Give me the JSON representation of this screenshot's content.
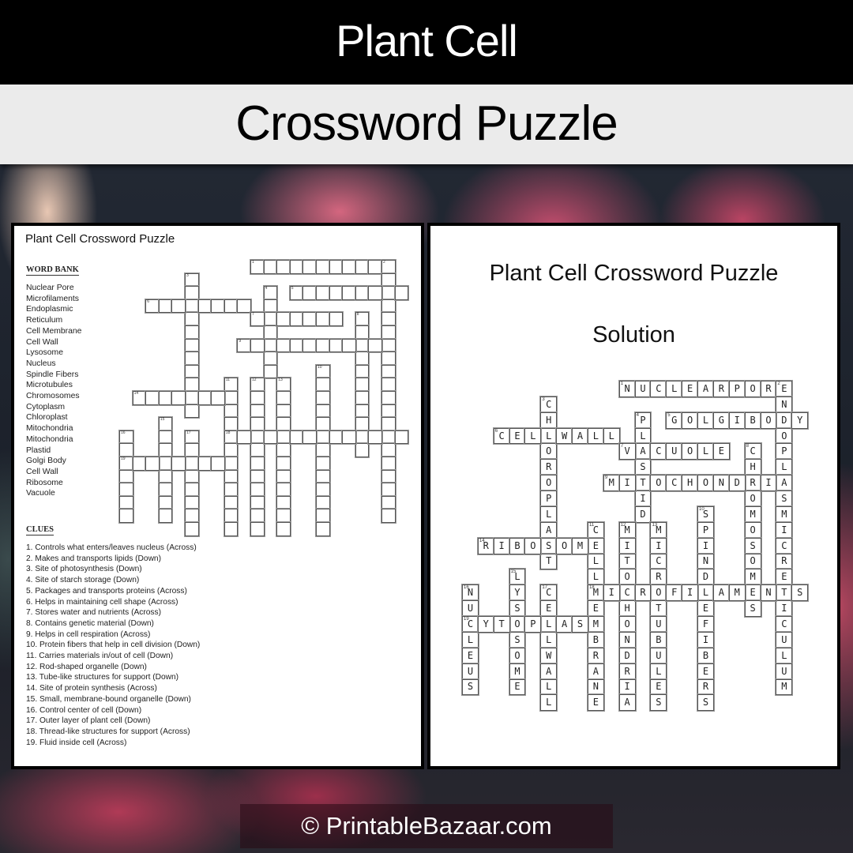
{
  "header": {
    "title": "Plant Cell",
    "subtitle": "Crossword Puzzle"
  },
  "puzzle_page": {
    "title": "Plant Cell Crossword Puzzle",
    "word_bank_heading": "WORD BANK",
    "word_bank": [
      "Nuclear Pore",
      "Microfilaments",
      "Endoplasmic",
      "Reticulum",
      "Cell Membrane",
      "Cell Wall",
      "Lysosome",
      "Nucleus",
      "Spindle Fibers",
      "Microtubules",
      "Chromosomes",
      "Cytoplasm",
      "Chloroplast",
      "Mitochondria",
      "Mitochondria",
      "Plastid",
      "Golgi Body",
      "Cell Wall",
      "Ribosome",
      "Vacuole"
    ],
    "clues_heading": "CLUES",
    "clues": [
      "1. Controls what enters/leaves nucleus (Across)",
      "2. Makes and transports lipids (Down)",
      "3. Site of photosynthesis (Down)",
      "4. Site of starch storage (Down)",
      "5. Packages and transports proteins (Across)",
      "6. Helps in maintaining cell shape (Across)",
      "7. Stores water and nutrients  (Across)",
      "8. Contains genetic material (Down)",
      "9. Helps in cell respiration (Across)",
      "10. Protein fibers that help in cell division (Down)",
      "11. Carries materials in/out of cell (Down)",
      "12. Rod-shaped organelle (Down)",
      "13. Tube-like structures for support  (Down)",
      "14. Site of protein synthesis (Across)",
      "15. Small, membrane-bound  organelle (Down)",
      "16. Control center of cell (Down)",
      "17. Outer layer of plant cell (Down)",
      "18. Thread-like structures for support  (Across)",
      "19. Fluid inside cell (Across)"
    ]
  },
  "solution_page": {
    "title": "Plant Cell Crossword Puzzle",
    "subtitle": "Solution"
  },
  "crossword": {
    "words": [
      {
        "num": 1,
        "answer": "NUCLEARPORE",
        "dir": "across",
        "row": 0,
        "col": 10
      },
      {
        "num": 2,
        "answer": "ENDOPLASMICRETICULUM",
        "dir": "down",
        "row": 0,
        "col": 20
      },
      {
        "num": 3,
        "answer": "CHLOROPLAST",
        "dir": "down",
        "row": 1,
        "col": 5
      },
      {
        "num": 4,
        "answer": "PLASTID",
        "dir": "down",
        "row": 2,
        "col": 11
      },
      {
        "num": 5,
        "answer": "GOLGIBODY",
        "dir": "across",
        "row": 2,
        "col": 13
      },
      {
        "num": 6,
        "answer": "CELLWALL",
        "dir": "across",
        "row": 3,
        "col": 2
      },
      {
        "num": 7,
        "answer": "VACUOLE",
        "dir": "across",
        "row": 4,
        "col": 10
      },
      {
        "num": 8,
        "answer": "CHROMOSOMES",
        "dir": "down",
        "row": 4,
        "col": 18
      },
      {
        "num": 9,
        "answer": "MITOCHONDRIA",
        "dir": "across",
        "row": 6,
        "col": 9
      },
      {
        "num": 10,
        "answer": "SPINDLEFIBERS",
        "dir": "down",
        "row": 8,
        "col": 15
      },
      {
        "num": 11,
        "answer": "CELLMEMBRANE",
        "dir": "down",
        "row": 9,
        "col": 8
      },
      {
        "num": 12,
        "answer": "MITOCHONDRIA",
        "dir": "down",
        "row": 9,
        "col": 10
      },
      {
        "num": 13,
        "answer": "MICROTUBULES",
        "dir": "down",
        "row": 9,
        "col": 12
      },
      {
        "num": 14,
        "answer": "RIBOSOME",
        "dir": "across",
        "row": 10,
        "col": 1
      },
      {
        "num": 15,
        "answer": "LYSOSOME",
        "dir": "down",
        "row": 12,
        "col": 3
      },
      {
        "num": 16,
        "answer": "NUCLEUS",
        "dir": "down",
        "row": 13,
        "col": 0
      },
      {
        "num": 17,
        "answer": "CELLWALL",
        "dir": "down",
        "row": 13,
        "col": 5
      },
      {
        "num": 18,
        "answer": "MICROFILAMENTS",
        "dir": "across",
        "row": 13,
        "col": 8
      },
      {
        "num": 19,
        "answer": "CYTOPLASM",
        "dir": "across",
        "row": 15,
        "col": 0
      }
    ]
  },
  "footer": {
    "copyright_icon": "copyright-icon",
    "copyright_symbol": "©",
    "site": "PrintableBazaar.com"
  }
}
